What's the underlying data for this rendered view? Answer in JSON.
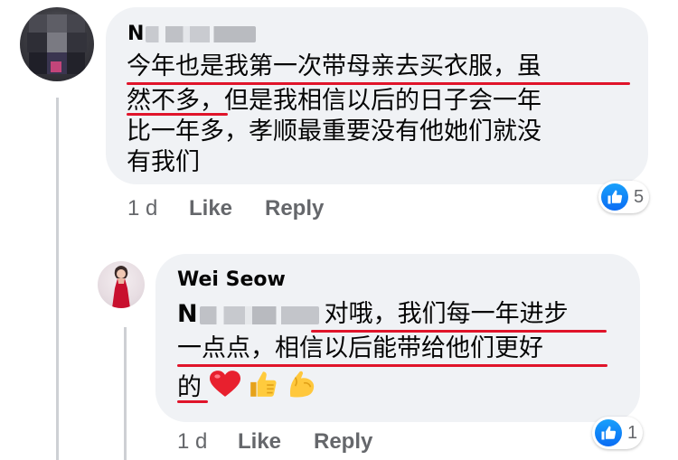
{
  "comment": {
    "author_initial": "N",
    "lines": [
      "今年也是我第一次带母亲去买衣服，虽",
      "然不多，但是我相信以后的日子会一年",
      "比一年多，孝顺最重要没有他她们就没",
      "有我们"
    ],
    "time": "1 d",
    "like_label": "Like",
    "reply_label": "Reply",
    "reaction_count": "5"
  },
  "reply": {
    "author": "Wei Seow",
    "mention_initial": "N",
    "line1": "对哦，我们每一年进步",
    "line2": "一点点，相信以后能带给他们更好",
    "line3": "的",
    "time": "1 d",
    "like_label": "Like",
    "reply_label": "Reply",
    "reaction_count": "1"
  },
  "colors": {
    "bubble": "#f0f2f5",
    "meta_text": "#65676b",
    "underline": "#e0142a",
    "like_blue": "#0a6cf4",
    "thread_line": "#ced0d4"
  }
}
